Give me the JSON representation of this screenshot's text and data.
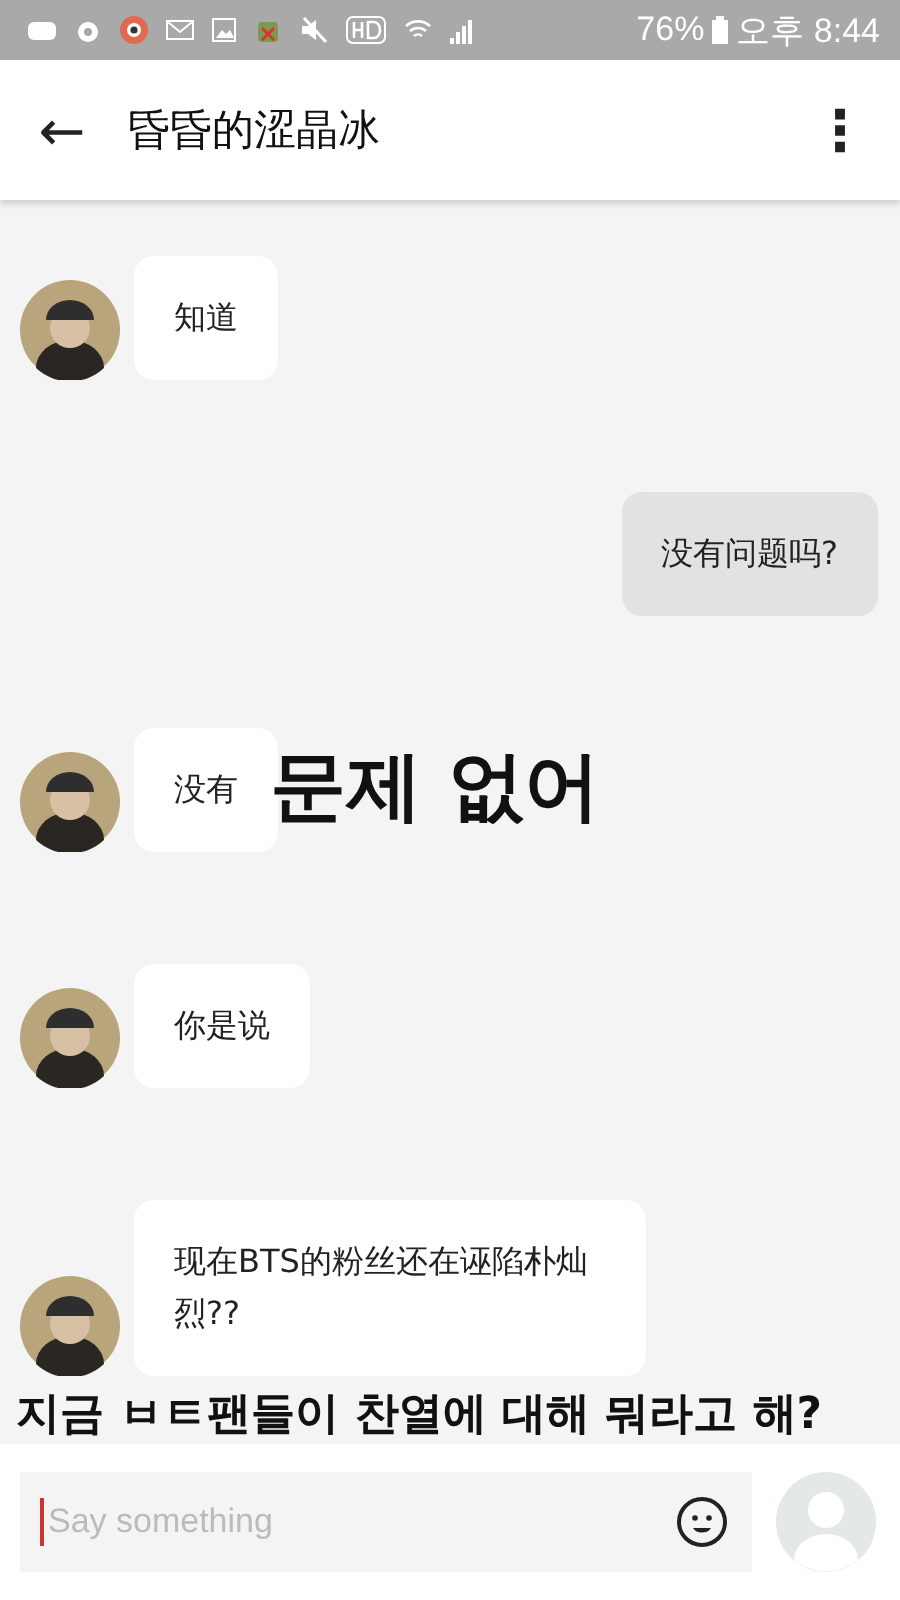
{
  "status_bar": {
    "battery": "76%",
    "time": "오후 8:44"
  },
  "header": {
    "back": "←",
    "title": "昏昏的涩晶冰",
    "menu": "⋮"
  },
  "messages": [
    {
      "kind": "received",
      "text": "知道"
    },
    {
      "kind": "sent",
      "text": "没有问题吗?"
    },
    {
      "kind": "received",
      "text": "没有",
      "caption": "문제 없어"
    },
    {
      "kind": "received",
      "text": "你是说"
    },
    {
      "kind": "received",
      "text": "现在BTS的粉丝还在诬陷朴灿烈??",
      "caption": "지금 ㅂㅌ팬들이 찬열에 대해 뭐라고 해?"
    }
  ],
  "composer": {
    "placeholder": "Say something"
  }
}
